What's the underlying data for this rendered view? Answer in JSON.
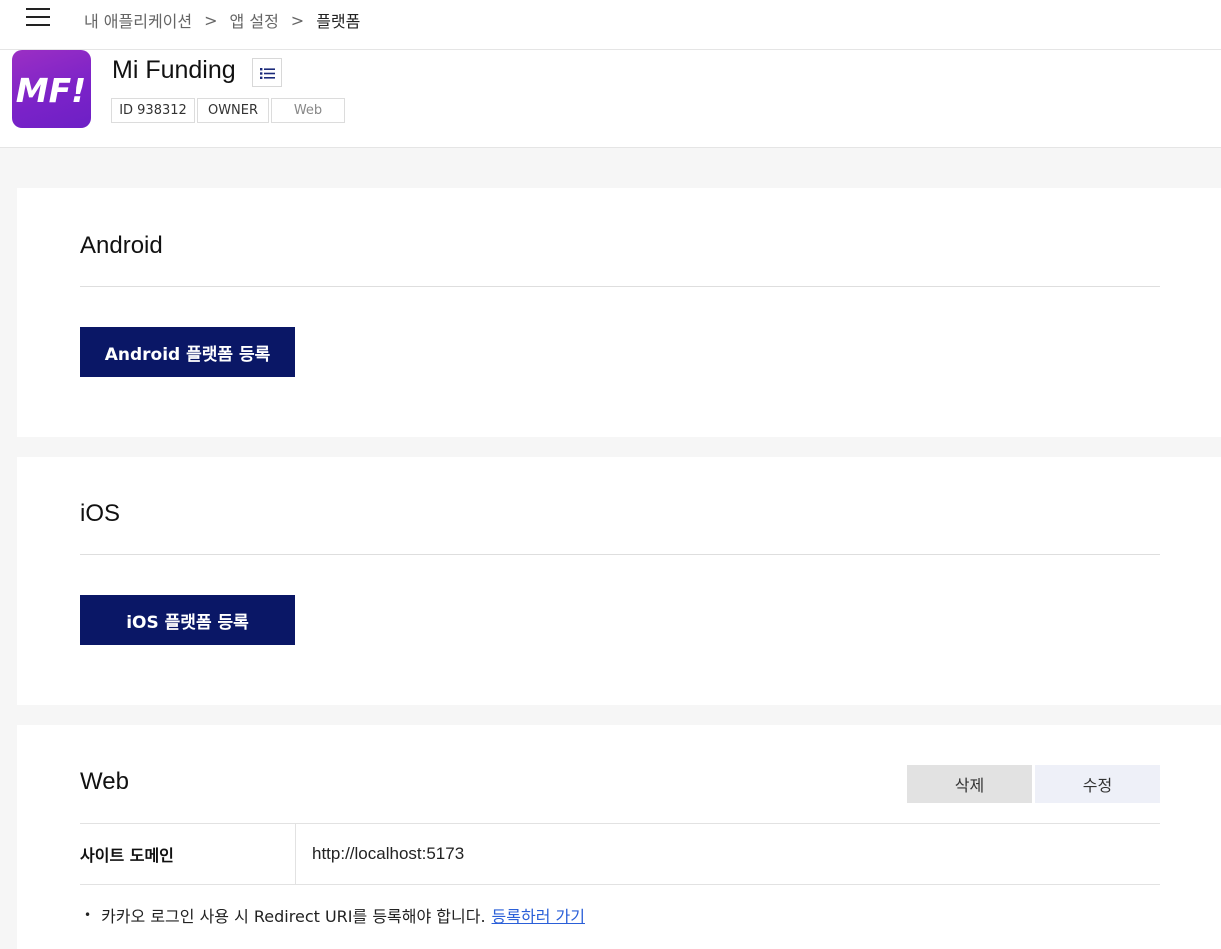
{
  "breadcrumb": {
    "items": [
      "내 애플리케이션",
      "앱 설정"
    ],
    "separator": ">",
    "current": "플랫폼"
  },
  "app": {
    "icon_text": "MF!",
    "name": "Mi Funding",
    "tags": {
      "id": "ID 938312",
      "role": "OWNER",
      "platform": "Web"
    }
  },
  "android": {
    "title": "Android",
    "register_label": "Android 플랫폼 등록"
  },
  "ios": {
    "title": "iOS",
    "register_label": "iOS 플랫폼 등록"
  },
  "web": {
    "title": "Web",
    "delete_label": "삭제",
    "edit_label": "수정",
    "domain_label": "사이트 도메인",
    "domain_value": "http://localhost:5173",
    "notice_text": "카카오 로그인 사용 시 Redirect URI를 등록해야 합니다.",
    "notice_link": "등록하러 가기"
  },
  "colors": {
    "primary_button": "#0a1766",
    "app_icon": "#7a22c8",
    "link": "#2a5fd8"
  },
  "icons": {
    "menu": "hamburger-menu-icon",
    "list": "list-icon"
  }
}
